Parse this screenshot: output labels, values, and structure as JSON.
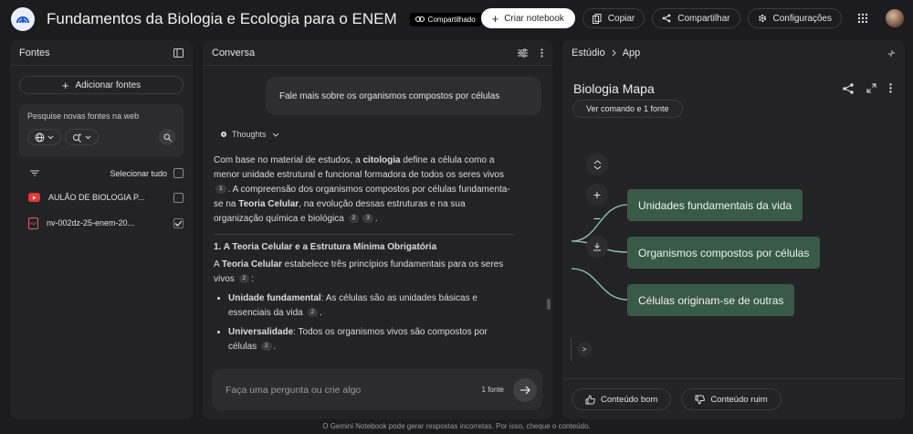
{
  "app": {
    "title": "Fundamentos da Biologia e Ecologia para o ENEM",
    "shared_badge": "Compartilhado"
  },
  "header_actions": {
    "create": "Criar notebook",
    "copy": "Copiar",
    "share": "Compartilhar",
    "settings": "Configurações"
  },
  "sources": {
    "title": "Fontes",
    "add": "Adicionar fontes",
    "search_placeholder": "Pesquise novas fontes na web",
    "select_all": "Selecionar tudo",
    "items": [
      {
        "name": "AULÃO DE BIOLOGIA P...",
        "type": "youtube",
        "checked": false
      },
      {
        "name": "nv-002dz-25-enem-20...",
        "type": "pdf",
        "checked": true
      }
    ]
  },
  "chat": {
    "title": "Conversa",
    "user_message": "Fale mais sobre os organismos compostos por células",
    "thoughts": "Thoughts",
    "answer": {
      "p1_a": "Com base no material de estudos, a ",
      "p1_b": "citologia",
      "p1_c": " define a célula como a menor unidade estrutural e funcional formadora de todos os seres vivos ",
      "cite1": "1",
      "p1_d": ". A compreensão dos organismos compostos por células fundamenta-se na ",
      "p1_e": "Teoria Celular",
      "p1_f": ", na evolução dessas estruturas e na sua organização química e biológica ",
      "cite2": "2",
      "cite3": "3",
      "p1_g": ".",
      "h1": "1. A Teoria Celular e a Estrutura Mínima Obrigatória",
      "p2_a": "A ",
      "p2_b": "Teoria Celular",
      "p2_c": " estabelece três princípios fundamentais para os seres vivos ",
      "p2_d": ":",
      "li1_b": "Unidade fundamental",
      "li1_t": ": As células são as unidades básicas e essenciais da vida ",
      "li2_b": "Universalidade",
      "li2_t": ": Todos os organismos vivos são compostos por células "
    },
    "composer_placeholder": "Faça uma pergunta ou crie algo",
    "source_count": "1 fonte"
  },
  "studio": {
    "crumb_root": "Estúdio",
    "crumb_current": "App",
    "map_title": "Biologia Mapa",
    "map_sub": "Ver comando e 1 fonte",
    "nodes": [
      "Unidades fundamentais da vida",
      "Organismos compostos por células",
      "Células originam-se de outras"
    ],
    "expand_glyph": ">",
    "feedback_good": "Conteúdo bom",
    "feedback_bad": "Conteúdo ruim"
  },
  "footer": "O Gemini Notebook pode gerar respostas incorretas. Por isso, cheque o conteúdo.",
  "colors": {
    "background": "#1c1c1e",
    "panel": "#232326",
    "node": "#3a5a48",
    "connector": "#8fc9b4"
  }
}
